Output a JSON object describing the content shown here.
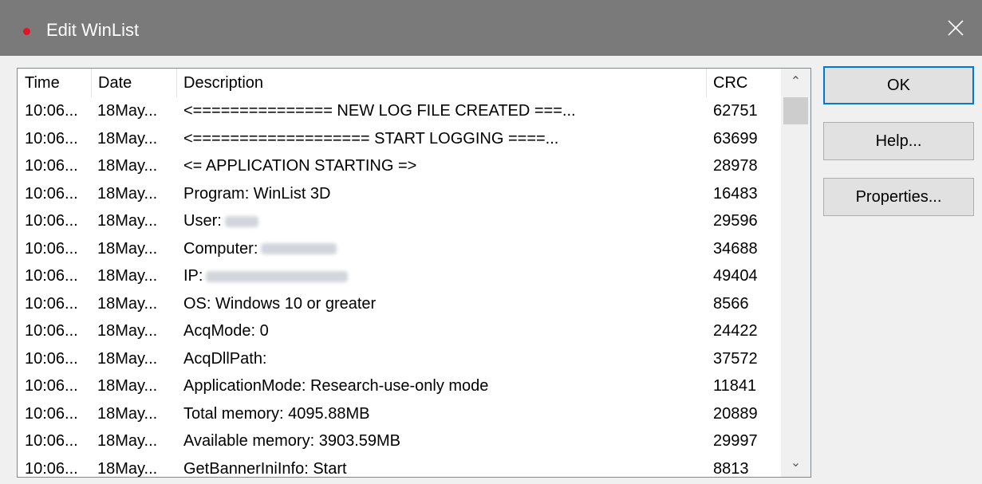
{
  "window": {
    "title": "Edit WinList",
    "close_glyph": "✕",
    "accent": "#e81123"
  },
  "columns": {
    "time": "Time",
    "date": "Date",
    "description": "Description",
    "crc": "CRC"
  },
  "rows": [
    {
      "time": "10:06...",
      "date": "18May...",
      "desc": "<===============  NEW LOG FILE CREATED ===...",
      "crc": "62751"
    },
    {
      "time": "10:06...",
      "date": "18May...",
      "desc": "<=================== START LOGGING ====...",
      "crc": "63699"
    },
    {
      "time": "10:06...",
      "date": "18May...",
      "desc": "<= APPLICATION STARTING =>",
      "crc": "28978"
    },
    {
      "time": "10:06...",
      "date": "18May...",
      "desc": "Program: WinList 3D",
      "crc": "16483"
    },
    {
      "time": "10:06...",
      "date": "18May...",
      "desc": "User:",
      "crc": "29596"
    },
    {
      "time": "10:06...",
      "date": "18May...",
      "desc": "Computer:",
      "crc": "34688"
    },
    {
      "time": "10:06...",
      "date": "18May...",
      "desc": "IP:",
      "crc": "49404"
    },
    {
      "time": "10:06...",
      "date": "18May...",
      "desc": "OS: Windows 10 or greater",
      "crc": "8566"
    },
    {
      "time": "10:06...",
      "date": "18May...",
      "desc": "AcqMode: 0",
      "crc": "24422"
    },
    {
      "time": "10:06...",
      "date": "18May...",
      "desc": "AcqDllPath:",
      "crc": "37572"
    },
    {
      "time": "10:06...",
      "date": "18May...",
      "desc": "ApplicationMode: Research-use-only mode",
      "crc": "11841"
    },
    {
      "time": "10:06...",
      "date": "18May...",
      "desc": "Total memory: 4095.88MB",
      "crc": "20889"
    },
    {
      "time": "10:06...",
      "date": "18May...",
      "desc": "Available memory: 3903.59MB",
      "crc": "29997"
    },
    {
      "time": "10:06...",
      "date": "18May...",
      "desc": "GetBannerIniInfo: Start",
      "crc": "8813"
    }
  ],
  "scrollbar": {
    "up_glyph": "⌃",
    "down_glyph": "⌄"
  },
  "buttons": {
    "ok": "OK",
    "help": "Help...",
    "properties": "Properties..."
  }
}
